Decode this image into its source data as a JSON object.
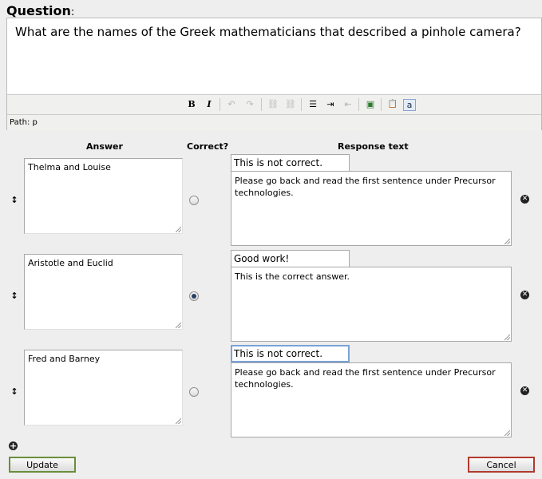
{
  "question": {
    "label": "Question",
    "colon": ":",
    "text": "What are the names of the Greek mathematicians that described a pinhole camera?"
  },
  "editor": {
    "toolbar": [
      {
        "icon": "bold-icon",
        "glyph": "B",
        "enabled": true
      },
      {
        "icon": "italic-icon",
        "glyph": "I",
        "enabled": true
      },
      {
        "icon": "undo-icon",
        "glyph": "↶",
        "enabled": false
      },
      {
        "icon": "redo-icon",
        "glyph": "↷",
        "enabled": false
      },
      {
        "icon": "link-icon",
        "glyph": "⛓",
        "enabled": false
      },
      {
        "icon": "unlink-icon",
        "glyph": "⛓",
        "enabled": false
      },
      {
        "icon": "bullet-list-icon",
        "glyph": "☰",
        "enabled": true
      },
      {
        "icon": "indent-icon",
        "glyph": "⇥",
        "enabled": true
      },
      {
        "icon": "outdent-icon",
        "glyph": "⇤",
        "enabled": false
      },
      {
        "icon": "insert-image-icon",
        "glyph": "▣",
        "enabled": true
      },
      {
        "icon": "paste-text-icon",
        "glyph": "📋",
        "enabled": true
      },
      {
        "icon": "paste-word-icon",
        "glyph": "a",
        "enabled": true
      }
    ],
    "path_label": "Path: p"
  },
  "columns": {
    "answer": "Answer",
    "correct": "Correct?",
    "response": "Response text"
  },
  "answers": [
    {
      "answer": "Thelma and Louise",
      "correct": false,
      "response_short": "This is not correct.",
      "response_long": "Please go back and read the first sentence under Precursor technologies."
    },
    {
      "answer": "Aristotle and Euclid",
      "correct": true,
      "response_short": "Good work!",
      "response_long": "This is the correct answer."
    },
    {
      "answer": "Fred and Barney",
      "correct": false,
      "response_short": "This is not correct.",
      "response_long": "Please go back and read the first sentence under Precursor technologies."
    }
  ],
  "icons": {
    "drag": "drag-handle-icon",
    "delete": "delete-icon",
    "add": "add-icon"
  },
  "buttons": {
    "update": "Update",
    "cancel": "Cancel"
  }
}
